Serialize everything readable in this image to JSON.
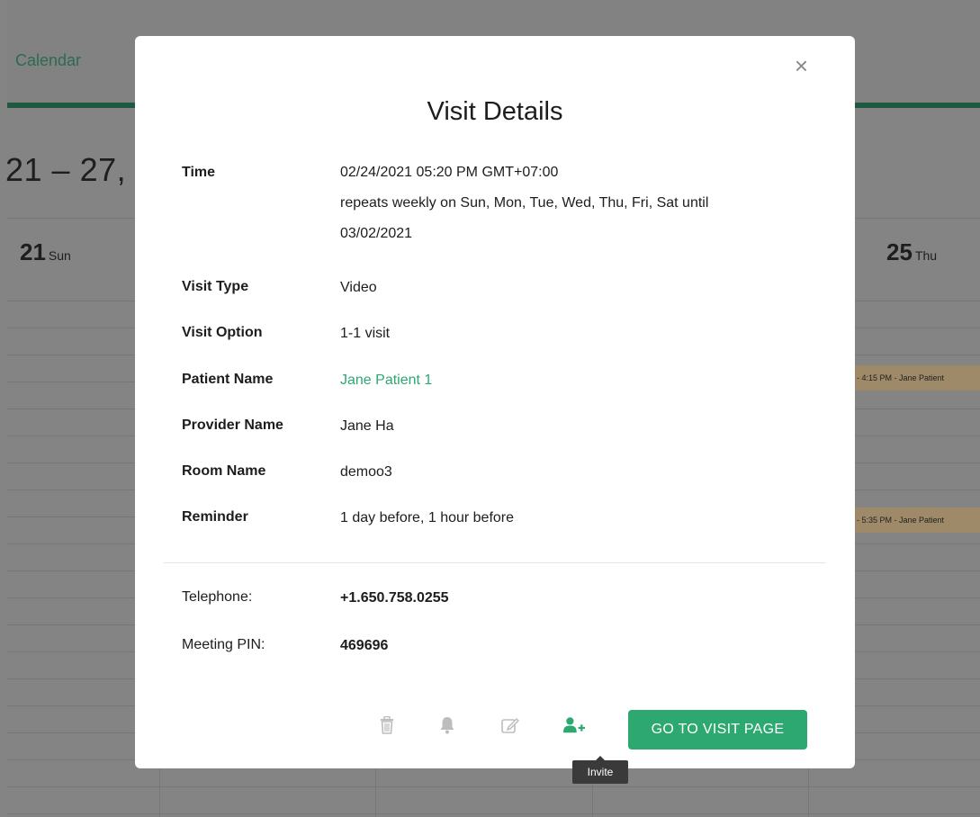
{
  "background": {
    "nav_label": "Calendar",
    "date_range": "21 – 27, 20",
    "days": [
      {
        "num": "21",
        "dow": "Sun"
      },
      {
        "num": "25",
        "dow": "Thu"
      }
    ],
    "events": [
      "- 4:15 PM - Jane Patient",
      "- 5:35 PM - Jane Patient"
    ]
  },
  "modal": {
    "title": "Visit Details",
    "close_glyph": "×",
    "time_label": "Time",
    "time_value": "02/24/2021 05:20 PM GMT+07:00",
    "time_repeat": "repeats weekly on Sun, Mon, Tue, Wed, Thu, Fri, Sat until",
    "time_until": "03/02/2021",
    "fields": [
      {
        "label": "Visit Type",
        "value": "Video"
      },
      {
        "label": "Visit Option",
        "value": "1-1 visit"
      },
      {
        "label": "Patient Name",
        "value": "Jane Patient 1"
      },
      {
        "label": "Provider Name",
        "value": "Jane Ha"
      },
      {
        "label": "Room Name",
        "value": "demoo3"
      },
      {
        "label": "Reminder",
        "value": "1 day before, 1 hour before"
      }
    ],
    "telephone_label": "Telephone:",
    "telephone_value": "+1.650.758.0255",
    "pin_label": "Meeting PIN:",
    "pin_value": "469696",
    "go_button": "GO TO VISIT PAGE",
    "tooltip": "Invite",
    "icons": [
      "trash-icon",
      "bell-icon",
      "edit-icon",
      "invite-user-icon"
    ],
    "colors": {
      "accent": "#2ea871",
      "icon_muted": "#bdbdbd"
    }
  }
}
